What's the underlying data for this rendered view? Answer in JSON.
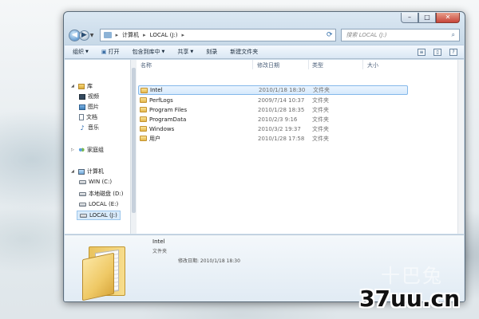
{
  "window": {
    "caption_buttons": {
      "minimize": "–",
      "maximize": "□",
      "close": "✕"
    }
  },
  "address": {
    "crumbs": [
      "计算机",
      "LOCAL (J:)"
    ],
    "separator": "▸",
    "search_placeholder": "搜索 LOCAL (J:)"
  },
  "toolbar": {
    "organize": "组织",
    "open": "打开",
    "include_in_library": "包含到库中",
    "share": "共享",
    "burn": "刻录",
    "new_folder": "新建文件夹"
  },
  "nav": {
    "library": "库",
    "video": "视频",
    "pictures": "图片",
    "documents": "文档",
    "music": "音乐",
    "homegroup": "家庭组",
    "computer": "计算机",
    "drives": [
      "WIN (C:)",
      "本地磁盘 (D:)",
      "LOCAL (E:)",
      "LOCAL (J:)"
    ]
  },
  "columns": {
    "name": "名称",
    "modified": "修改日期",
    "type": "类型",
    "size": "大小"
  },
  "files": [
    {
      "name": "Intel",
      "modified": "2010/1/18 18:30",
      "type": "文件夹"
    },
    {
      "name": "PerfLogs",
      "modified": "2009/7/14 10:37",
      "type": "文件夹"
    },
    {
      "name": "Program Files",
      "modified": "2010/1/28 18:35",
      "type": "文件夹"
    },
    {
      "name": "ProgramData",
      "modified": "2010/2/3 9:16",
      "type": "文件夹"
    },
    {
      "name": "Windows",
      "modified": "2010/3/2 19:37",
      "type": "文件夹"
    },
    {
      "name": "用户",
      "modified": "2010/1/28 17:58",
      "type": "文件夹"
    }
  ],
  "details": {
    "name": "Intel",
    "type": "文件夹",
    "modified": "修改日期: 2010/1/18 18:30"
  },
  "watermark": {
    "cn": "十巴兔",
    "site": "37uu.cn"
  }
}
